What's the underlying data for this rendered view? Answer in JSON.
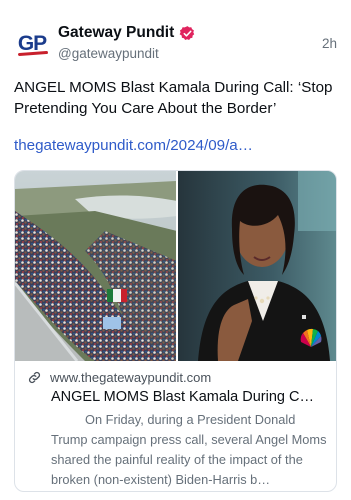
{
  "post": {
    "author": {
      "avatar_text": "GP",
      "display_name": "Gateway Pundit",
      "handle": "@gatewaypundit",
      "verified_icon": "verified-badge-icon",
      "verified_color": "#e0245e"
    },
    "time": "2h",
    "text": "ANGEL MOMS Blast Kamala During Call: ‘Stop Pretending You Care About the Border’",
    "link": "thegatewaypundit.com/2024/09/a…",
    "link_color": "#2f5bc9"
  },
  "card": {
    "domain_icon": "link-icon",
    "domain": "www.thegatewaypundit.com",
    "title": "ANGEL MOMS Blast Kamala During C…",
    "description": "On Friday, during a President Donald Trump campaign press call, several Angel Moms shared the painful reality of the impact of the broken (non-existent) Biden-Harris b…",
    "image_left": "crowd-photo",
    "image_right": "speaker-photo"
  }
}
